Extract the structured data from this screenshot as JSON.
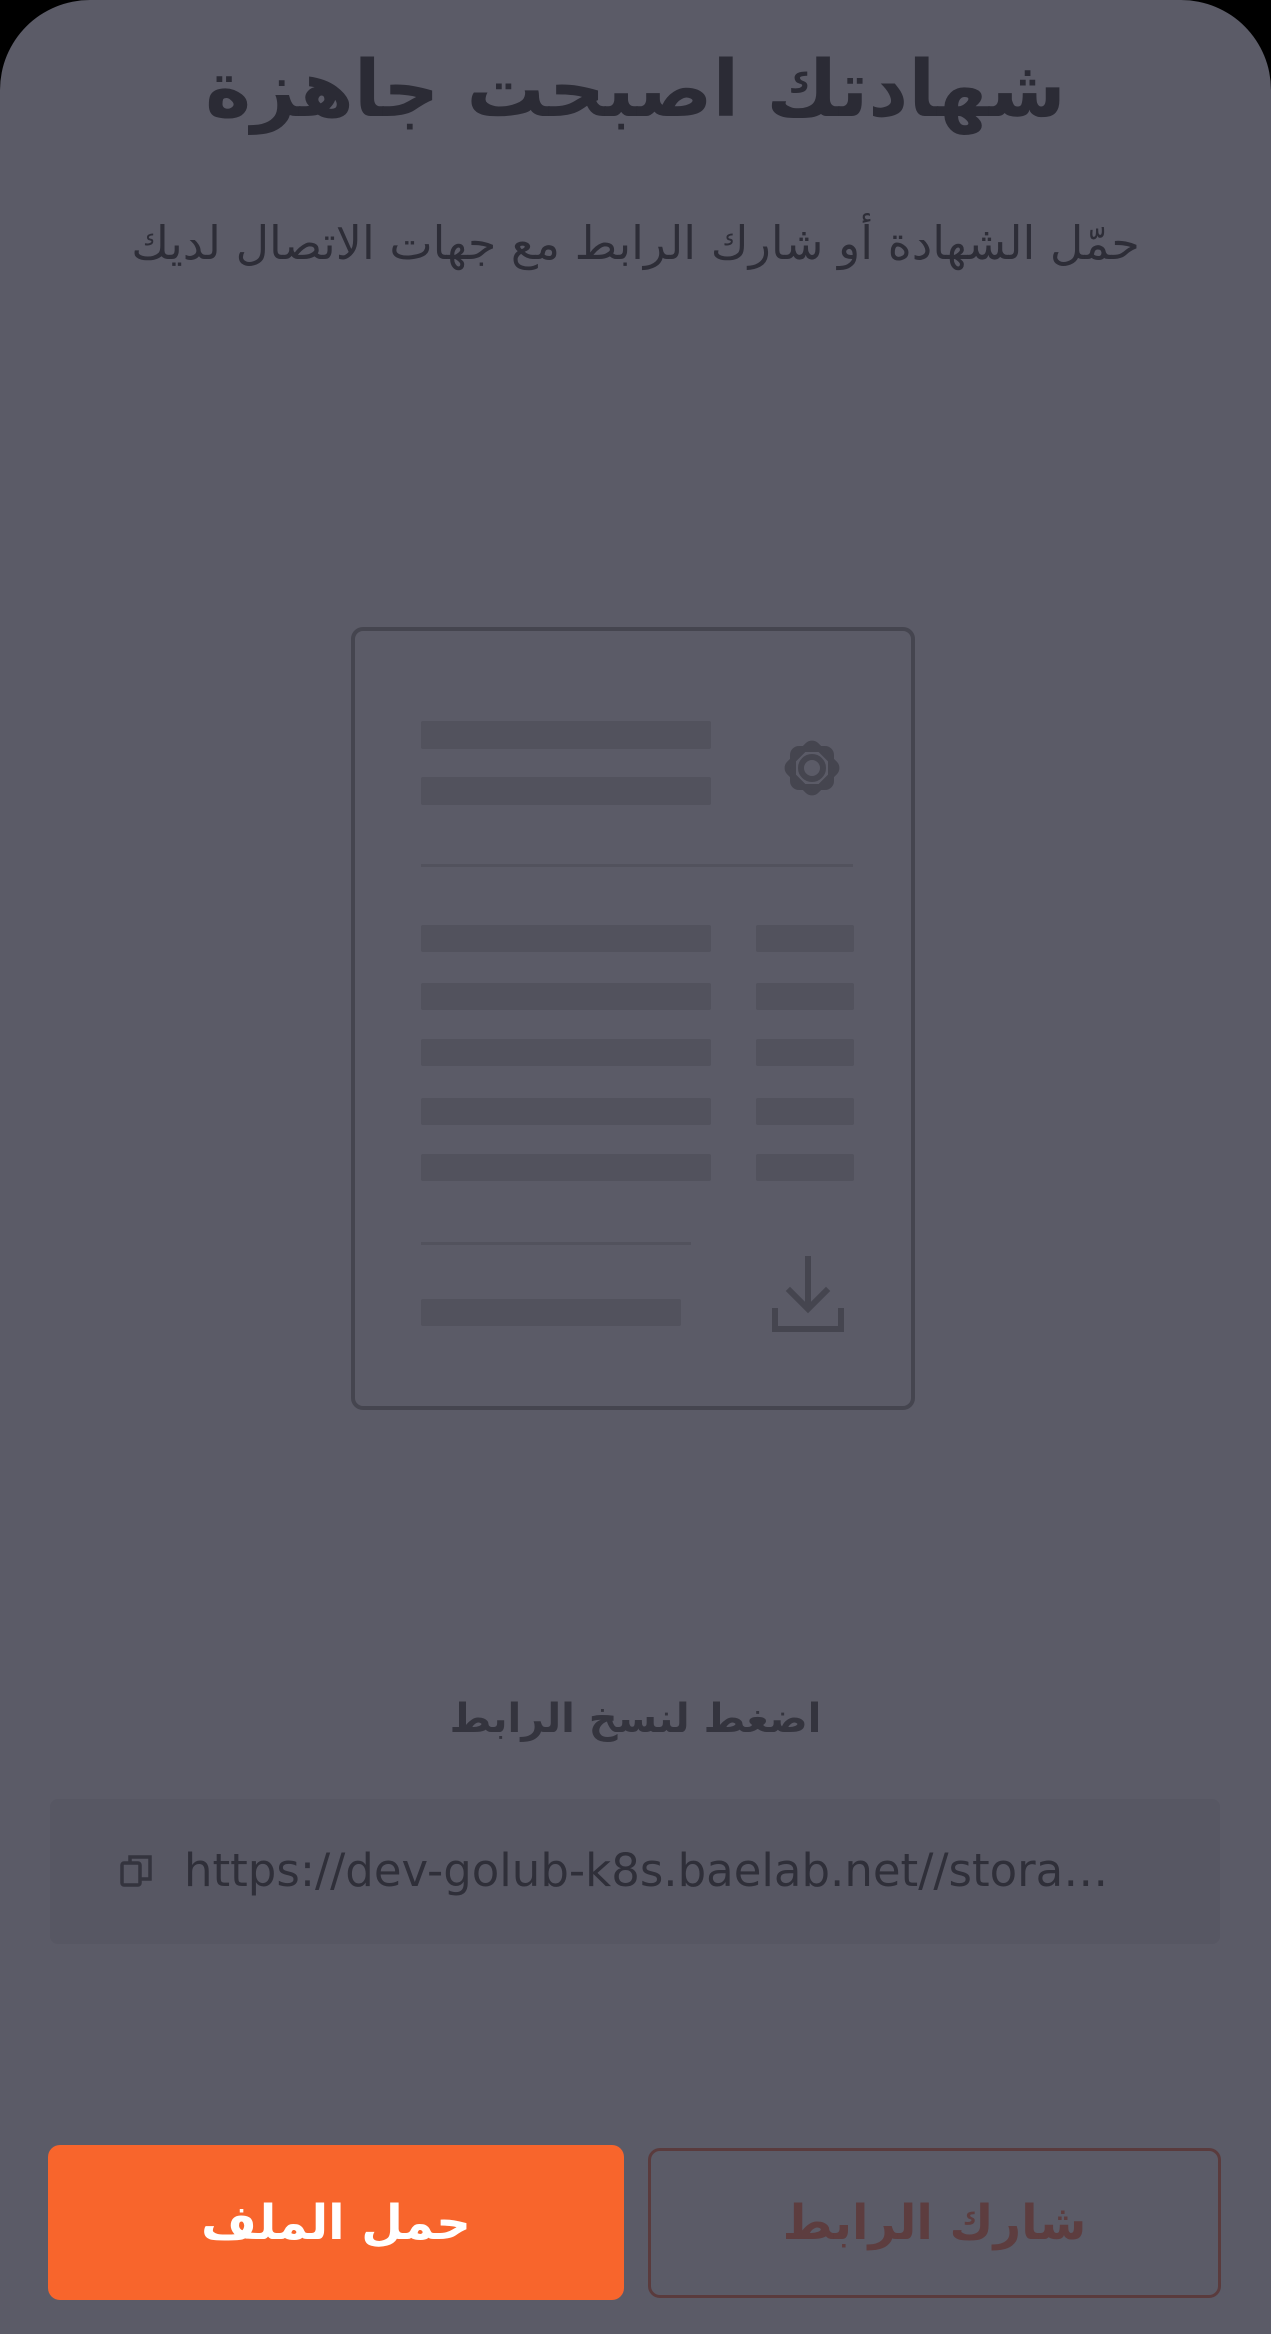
{
  "sheet": {
    "title": "شهادتك اصبحت جاهزة",
    "subtitle": "حمّل الشهادة أو شارك الرابط مع  جهات الاتصال لديك"
  },
  "illustration": {
    "emblem_icon": "emblem-icon",
    "download_icon": "download-icon"
  },
  "link_section": {
    "hint": "اضغط لنسخ الرابط",
    "url": "https://dev-golub-k8s.baelab.net//stora…",
    "copy_icon": "copy-icon"
  },
  "actions": {
    "download_label": "حمل الملف",
    "share_label": "شارك الرابط"
  },
  "colors": {
    "overlay_background": "#5b5b67",
    "primary_button": "#f8652c",
    "share_button_border": "#5a3b3d",
    "text_dark": "#2b2b35"
  }
}
